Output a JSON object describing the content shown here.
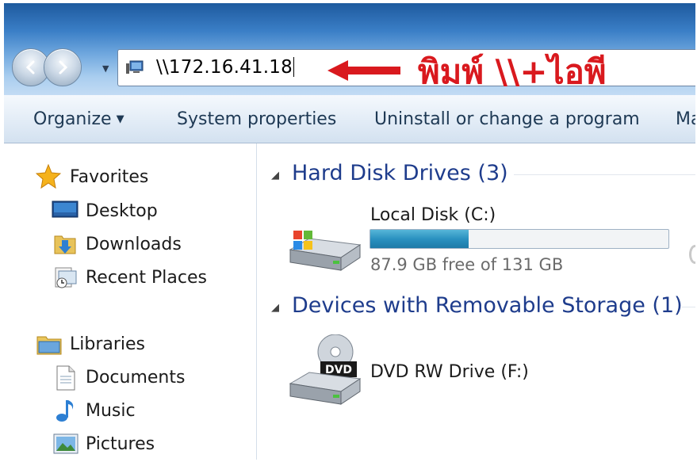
{
  "address_bar": {
    "path": "\\\\172.16.41.18"
  },
  "annotation": {
    "text": "พิมพ์ \\\\+ไอพี",
    "color": "#d9191e"
  },
  "toolbar": {
    "organize_label": "Organize",
    "system_properties_label": "System properties",
    "uninstall_label": "Uninstall or change a program",
    "more_label": "Ma"
  },
  "sidebar": {
    "favorites": {
      "label": "Favorites",
      "items": [
        {
          "label": "Desktop",
          "icon": "desktop-icon"
        },
        {
          "label": "Downloads",
          "icon": "downloads-icon"
        },
        {
          "label": "Recent Places",
          "icon": "recent-places-icon"
        }
      ]
    },
    "libraries": {
      "label": "Libraries",
      "items": [
        {
          "label": "Documents",
          "icon": "documents-icon"
        },
        {
          "label": "Music",
          "icon": "music-icon"
        },
        {
          "label": "Pictures",
          "icon": "pictures-icon"
        }
      ]
    }
  },
  "content": {
    "hard_disk_group": "Hard Disk Drives (3)",
    "local_disk": {
      "name": "Local Disk (C:)",
      "free_text": "87.9 GB free of 131 GB",
      "used_fraction": 0.33
    },
    "removable_group": "Devices with Removable Storage (1)",
    "dvd_drive": {
      "name": "DVD RW Drive (F:)",
      "badge": "DVD"
    }
  },
  "colors": {
    "group_header": "#1e3c8c",
    "bar_fill": "#2a91c0"
  }
}
